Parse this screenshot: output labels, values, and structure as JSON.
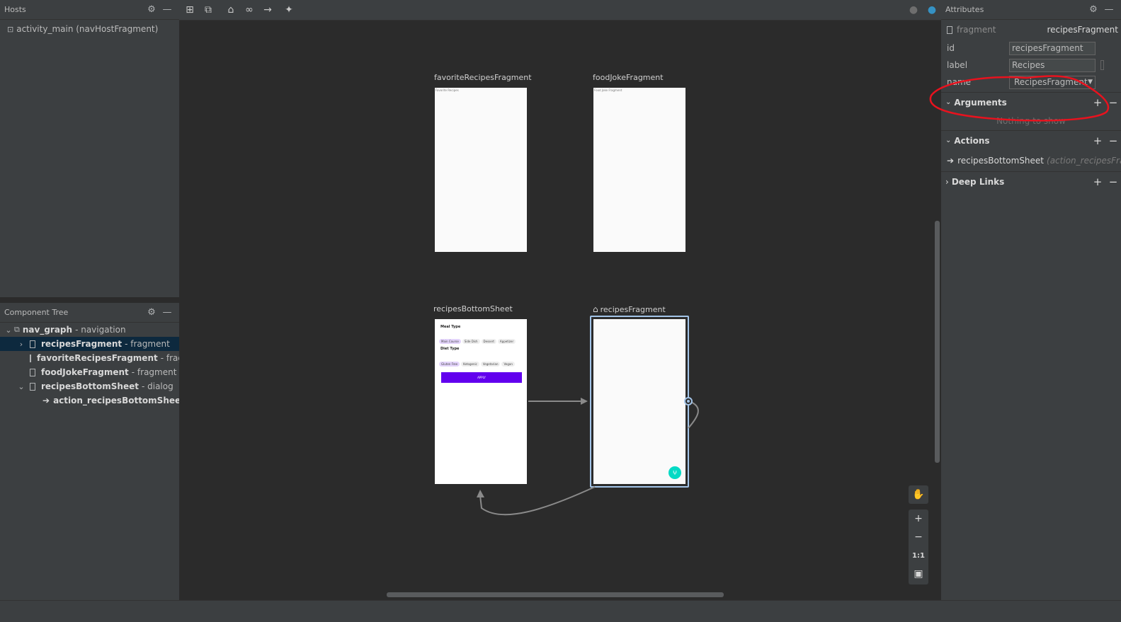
{
  "hosts": {
    "title": "Hosts",
    "item": "activity_main (navHostFragment)"
  },
  "component_tree": {
    "title": "Component Tree",
    "rows": [
      {
        "name": "nav_graph",
        "type": "- navigation"
      },
      {
        "name": "recipesFragment",
        "type": "- fragment"
      },
      {
        "name": "favoriteRecipesFragment",
        "type": "- fragme"
      },
      {
        "name": "foodJokeFragment",
        "type": "- fragment"
      },
      {
        "name": "recipesBottomSheet",
        "type": "- dialog"
      },
      {
        "name": "action_recipesBottomSheet_to_",
        "type": ""
      }
    ]
  },
  "canvas": {
    "fragments": {
      "favorite": {
        "label": "favoriteRecipesFragment",
        "content": "Favorite Recipes"
      },
      "foodjoke": {
        "label": "foodJokeFragment",
        "content": "Food Joke Fragment"
      },
      "bottomsheet": {
        "label": "recipesBottomSheet",
        "meal_type": "Meal Type",
        "meal_chips": [
          "Main Course",
          "Side Dish",
          "Dessert",
          "Appetizer"
        ],
        "diet_type": "Diet Type",
        "diet_chips": [
          "Gluten Free",
          "Ketogenic",
          "Vegetarian",
          "Vegan"
        ],
        "apply": "APPLY"
      },
      "recipes": {
        "label": "recipesFragment"
      }
    },
    "zoom": {
      "one_to_one": "1:1"
    }
  },
  "attributes": {
    "title": "Attributes",
    "type_label": "fragment",
    "type_value": "recipesFragment",
    "id_label": "id",
    "id_value": "recipesFragment",
    "label_label": "label",
    "label_value": "Recipes",
    "name_label": "name",
    "name_value": "RecipesFragment",
    "arguments": "Arguments",
    "nothing": "Nothing to show",
    "actions": "Actions",
    "action_item": "recipesBottomSheet",
    "action_item_detail": "(action_recipesFrag",
    "deep_links": "Deep Links"
  },
  "colors": {
    "accent_purple": "#6200ee",
    "fab_teal": "#03dac5",
    "selection": "#0d293e",
    "annotation_red": "#e8121e"
  }
}
